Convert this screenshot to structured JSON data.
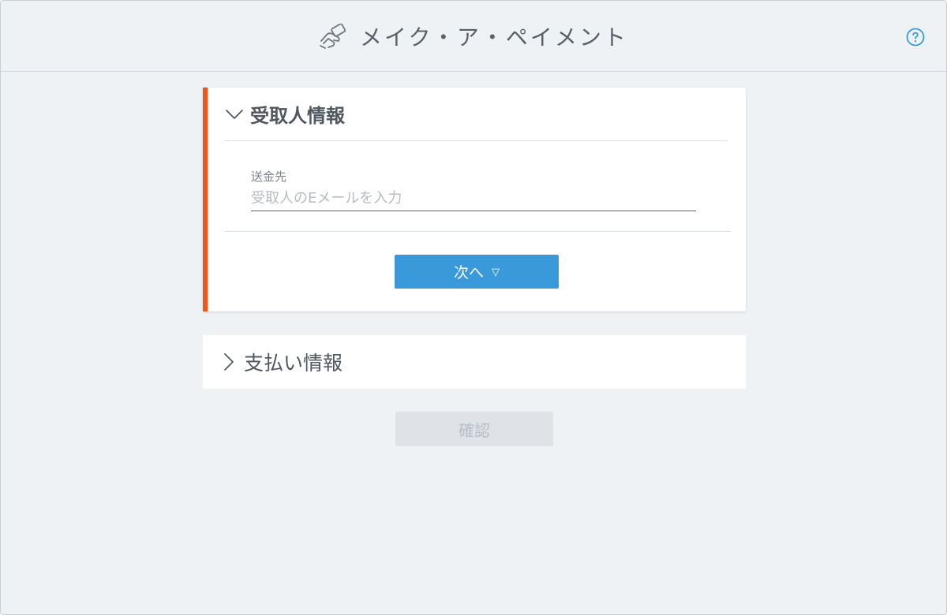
{
  "app": {
    "title": "メイク・ア・ペイメント",
    "icon": "hand-card-icon",
    "help_icon": "help-circle-icon"
  },
  "recipient_section": {
    "title": "受取人情報",
    "expanded": true,
    "field": {
      "label": "送金先",
      "value": "",
      "placeholder": "受取人のEメールを入力"
    },
    "next_button": {
      "label": "次へ",
      "icon": "▽"
    }
  },
  "payment_section": {
    "title": "支払い情報",
    "expanded": false
  },
  "confirm_button": {
    "label": "確認",
    "disabled": true
  },
  "colors": {
    "accent": "#f2561d",
    "primary": "#3a9ad9",
    "background": "#eff2f4",
    "text": "#4f575f"
  }
}
